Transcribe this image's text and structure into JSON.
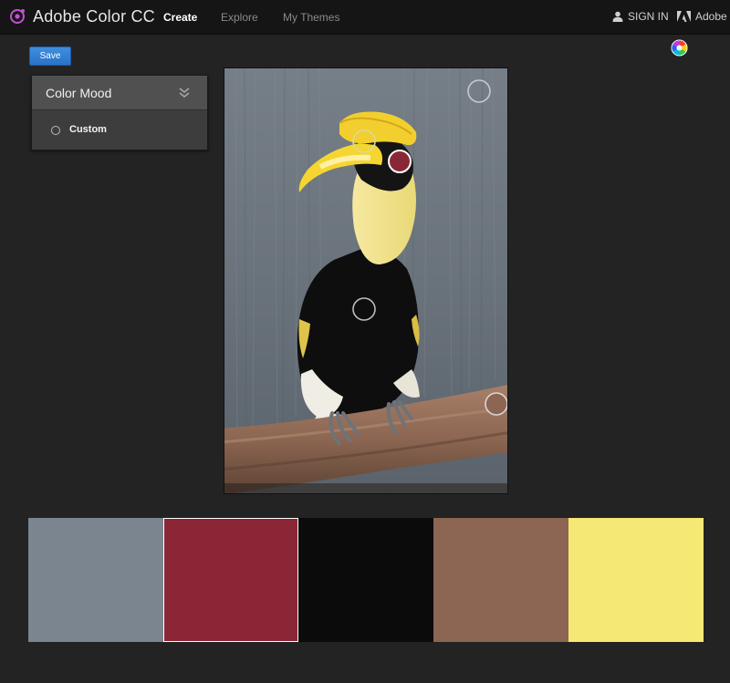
{
  "header": {
    "brand": "Adobe Color CC",
    "nav": [
      {
        "label": "Create",
        "active": true
      },
      {
        "label": "Explore",
        "active": false
      },
      {
        "label": "My Themes",
        "active": false
      }
    ],
    "signin_label": "SIGN IN",
    "adobe_label": "Adobe",
    "icons": {
      "logo": "adobe-color-logo-icon",
      "signin": "user-icon",
      "adobe": "adobe-logo-icon"
    }
  },
  "toolbar": {
    "save_label": "Save",
    "color_wheel_icon": "color-wheel-icon"
  },
  "color_mood": {
    "title": "Color Mood",
    "selected_option": "Custom"
  },
  "photo": {
    "subject": "hornbill",
    "sample_points": 5
  },
  "swatches": [
    {
      "color": "#7a8590",
      "selected": false
    },
    {
      "color": "#8b2636",
      "selected": true
    },
    {
      "color": "#0b0b0b",
      "selected": false
    },
    {
      "color": "#8c6652",
      "selected": false
    },
    {
      "color": "#f6e874",
      "selected": false
    }
  ],
  "colors": {
    "accent": "#2d7bd3",
    "background": "#232323",
    "topbar": "#151515"
  }
}
